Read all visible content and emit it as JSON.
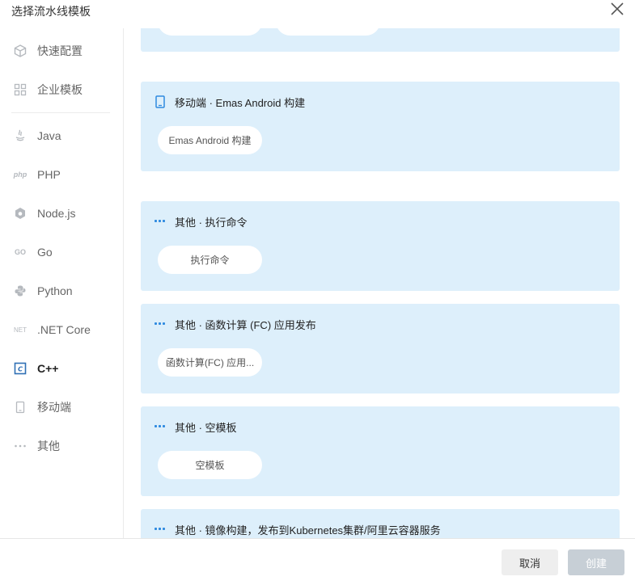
{
  "dialog": {
    "title": "选择流水线模板"
  },
  "sidebar": {
    "items": [
      {
        "label": "快速配置",
        "icon": "cube-icon"
      },
      {
        "label": "企业模板",
        "icon": "grid-icon"
      },
      {
        "label": "Java",
        "icon": "java-icon"
      },
      {
        "label": "PHP",
        "icon": "php-icon",
        "icon_text": "php"
      },
      {
        "label": "Node.js",
        "icon": "nodejs-icon"
      },
      {
        "label": "Go",
        "icon": "go-icon",
        "icon_text": "GO"
      },
      {
        "label": "Python",
        "icon": "python-icon"
      },
      {
        "label": ".NET Core",
        "icon": "dotnet-icon",
        "icon_text": "NET"
      },
      {
        "label": "C++",
        "icon": "cpp-icon",
        "icon_text": "C"
      },
      {
        "label": "移动端",
        "icon": "mobile-icon"
      },
      {
        "label": "其他",
        "icon": "more-icon"
      }
    ],
    "active": "C++"
  },
  "cards": [
    {
      "title": "",
      "pills": [
        "",
        ""
      ]
    },
    {
      "title": "移动端 · Emas Android 构建",
      "icon": "mobile-icon",
      "pill": "Emas Android 构建"
    },
    {
      "title": "其他 · 执行命令",
      "icon": "more-icon",
      "pill": "执行命令"
    },
    {
      "title": "其他 · 函数计算 (FC) 应用发布",
      "icon": "more-icon",
      "pill": "函数计算(FC) 应用..."
    },
    {
      "title": "其他 · 空模板",
      "icon": "more-icon",
      "pill": "空模板"
    },
    {
      "title": "其他 · 镜像构建，发布到Kubernetes集群/阿里云容器服务",
      "icon": "more-icon"
    }
  ],
  "footer": {
    "cancel_label": "取消",
    "create_label": "创建"
  },
  "colors": {
    "card_bg": "#ddeffb",
    "accent": "#2f8ae0",
    "create_disabled": "#c7cfd6"
  }
}
